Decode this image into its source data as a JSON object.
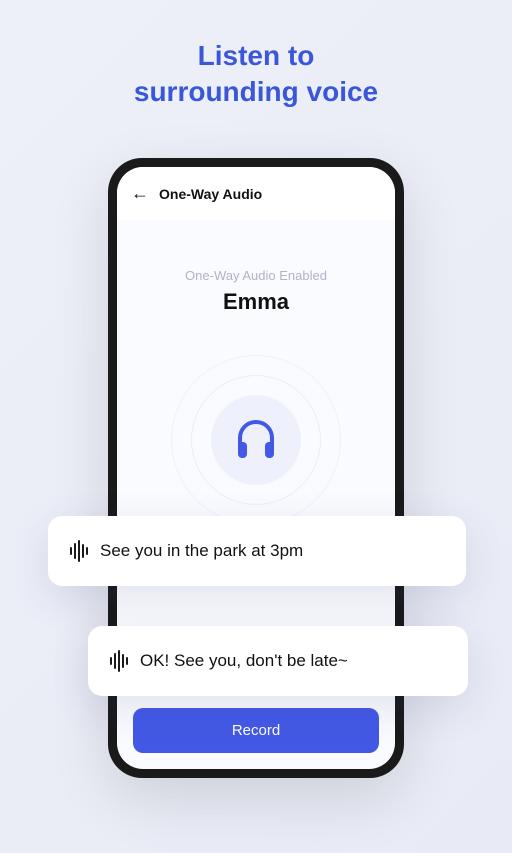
{
  "marketing": {
    "title_line1": "Listen to",
    "title_line2": "surrounding voice"
  },
  "header": {
    "title": "One-Way Audio"
  },
  "status": {
    "label": "One-Way Audio Enabled",
    "name": "Emma"
  },
  "bubbles": {
    "b1": "See you in the park at 3pm",
    "b2": "OK! See you, don't be late~"
  },
  "actions": {
    "record": "Record"
  }
}
